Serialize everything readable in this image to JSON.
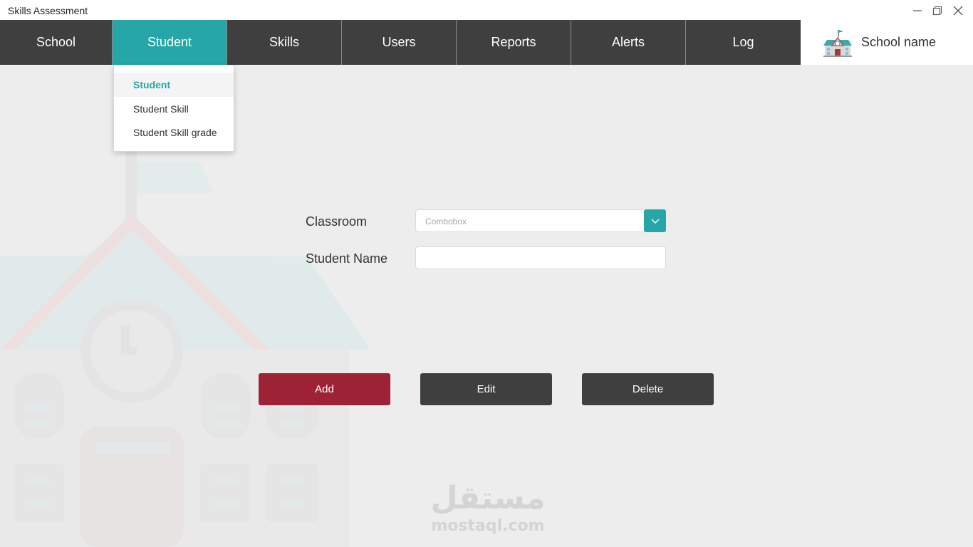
{
  "window": {
    "title": "Skills Assessment",
    "controls": [
      {
        "name": "minimize-button",
        "icon": "minimize-icon"
      },
      {
        "name": "maximize-button",
        "icon": "maximize-icon"
      },
      {
        "name": "close-button",
        "icon": "close-icon"
      }
    ]
  },
  "nav": {
    "items": [
      {
        "label": "School",
        "active": false
      },
      {
        "label": "Student",
        "active": true
      },
      {
        "label": "Skills",
        "active": false
      },
      {
        "label": "Users",
        "active": false
      },
      {
        "label": "Reports",
        "active": false
      },
      {
        "label": "Alerts",
        "active": false
      },
      {
        "label": "Log",
        "active": false
      }
    ],
    "school_name": "School name",
    "school_icon": "school-building-icon"
  },
  "dropdown": {
    "items": [
      {
        "label": "Student",
        "selected": true
      },
      {
        "label": "Student Skill",
        "selected": false
      },
      {
        "label": "Student Skill grade",
        "selected": false
      }
    ]
  },
  "form": {
    "classroom_label": "Classroom",
    "classroom_placeholder": "Combobox",
    "student_name_label": "Student Name",
    "student_name_value": ""
  },
  "actions": {
    "add_label": "Add",
    "edit_label": "Edit",
    "delete_label": "Delete"
  },
  "watermark": {
    "arabic": "مستقل",
    "latin": "mostaql.com"
  },
  "colors": {
    "accent": "#26a6a6",
    "nav_bg": "#3f3f3f",
    "add_button": "#9e2236",
    "background": "#ededed"
  }
}
